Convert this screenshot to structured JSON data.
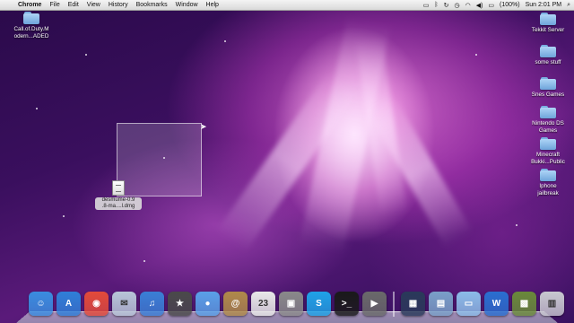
{
  "menubar": {
    "apple": "",
    "app_name": "Chrome",
    "items": [
      "File",
      "Edit",
      "View",
      "History",
      "Bookmarks",
      "Window",
      "Help"
    ],
    "battery": "(100%)",
    "clock": "Sun 2:01 PM",
    "status_icons": [
      "screen-icon",
      "bluetooth-icon",
      "sync-icon",
      "clock-icon",
      "wifi-icon",
      "volume-icon",
      "battery-icon",
      "search-icon"
    ]
  },
  "desktop_left": [
    {
      "label": "Call.of.Duty.M\nodern...ADED"
    }
  ],
  "desktop_right": [
    {
      "label": "Tekkit Server"
    },
    {
      "label": "some stuff"
    },
    {
      "label": "Snes Games"
    },
    {
      "label": "Nintendo DS\nGames"
    },
    {
      "label": "Minecraft\nBukki...Public"
    },
    {
      "label": "Iphone\njailbreak"
    }
  ],
  "dmg_file": {
    "label": "desmume-0.9\n.8-ma....l.dmg"
  },
  "dock": {
    "apps": [
      {
        "name": "finder-icon",
        "glyph": "☺",
        "color": "#3a8de0"
      },
      {
        "name": "app-store-icon",
        "glyph": "A",
        "color": "#2f7fd8"
      },
      {
        "name": "chrome-icon",
        "glyph": "◉",
        "color": "#e34b3a"
      },
      {
        "name": "preview-icon",
        "glyph": "✉",
        "color": "#b8c6d8"
      },
      {
        "name": "itunes-icon",
        "glyph": "♫",
        "color": "#3a7fd6"
      },
      {
        "name": "imovie-icon",
        "glyph": "★",
        "color": "#4a4a4a"
      },
      {
        "name": "facetime-icon",
        "glyph": "●",
        "color": "#5aa0e8"
      },
      {
        "name": "contacts-icon",
        "glyph": "@",
        "color": "#b08a4a"
      },
      {
        "name": "calendar-icon",
        "glyph": "23",
        "color": "#e8e8e8"
      },
      {
        "name": "photo-booth-icon",
        "glyph": "▣",
        "color": "#8a8a8a"
      },
      {
        "name": "skype-icon",
        "glyph": "S",
        "color": "#1fa3e8"
      },
      {
        "name": "terminal-icon",
        "glyph": ">_",
        "color": "#1a1a1a"
      },
      {
        "name": "movie-icon",
        "glyph": "▶",
        "color": "#6a6a6a"
      }
    ],
    "right_items": [
      {
        "name": "screenshot-icon",
        "glyph": "▦",
        "color": "#2a3a5a"
      },
      {
        "name": "downloads-stack-icon",
        "glyph": "▤",
        "color": "#7aa0c8"
      },
      {
        "name": "folder-stack-icon",
        "glyph": "▭",
        "color": "#8cbce8"
      },
      {
        "name": "word-icon",
        "glyph": "W",
        "color": "#2a6fd0"
      },
      {
        "name": "minecraft-icon",
        "glyph": "▩",
        "color": "#6a8a3a"
      },
      {
        "name": "trash-icon",
        "glyph": "▥",
        "color": "#c8c8d0"
      }
    ]
  }
}
